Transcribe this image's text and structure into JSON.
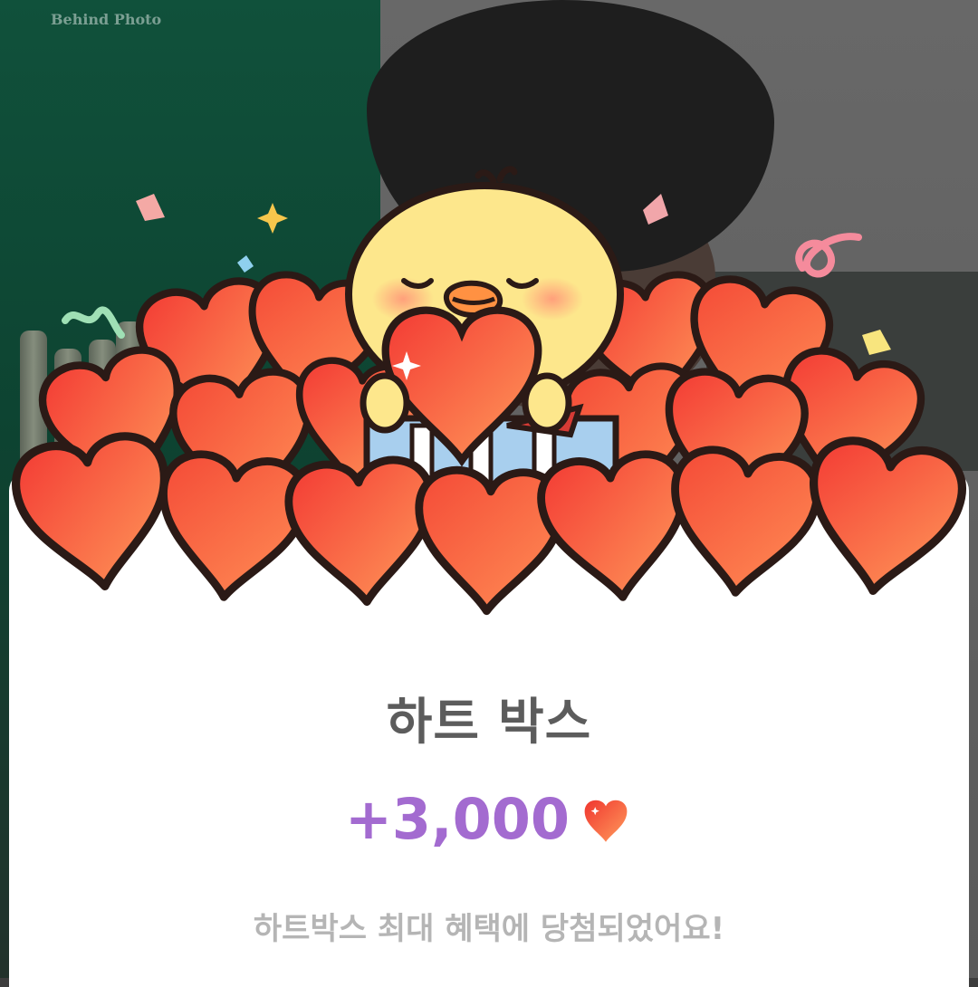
{
  "watermark": "Behind Photo",
  "reward": {
    "title": "하트 박스",
    "amount": "+3,000",
    "currency_icon": "heart-icon",
    "message": "하트박스 최대 혜택에 당첨되었어요!"
  },
  "colors": {
    "amount": "#a36bd0",
    "title": "#5c5c5c",
    "message": "#b5b5b5",
    "heart_fill": "#f6533c",
    "heart_fill_light": "#ff9b5c",
    "chick": "#fde78c"
  }
}
